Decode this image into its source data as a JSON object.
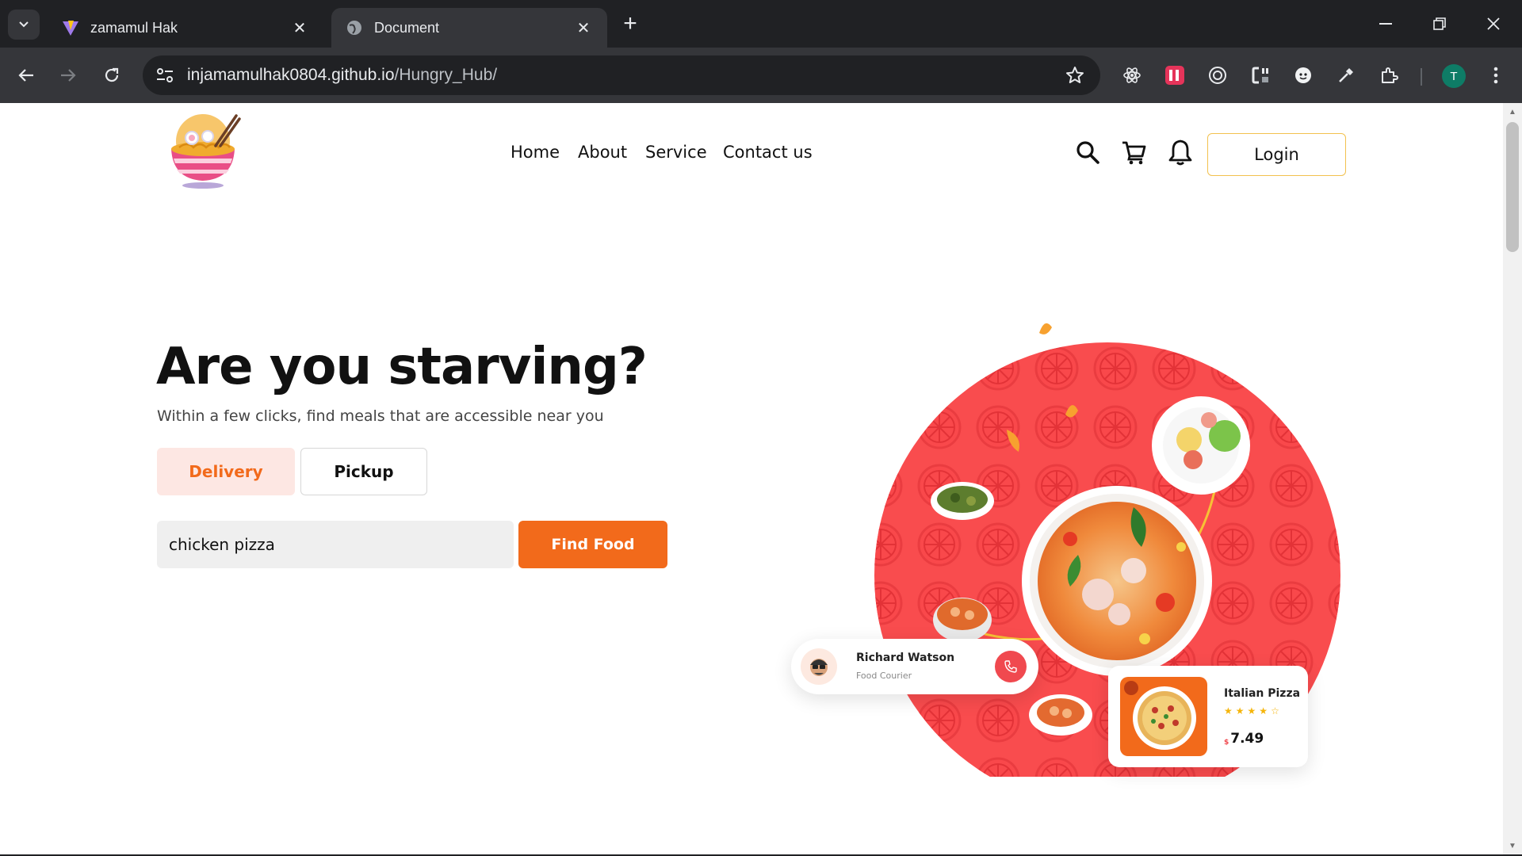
{
  "browser": {
    "tabs": [
      {
        "title": "zamamul Hak",
        "active": false
      },
      {
        "title": "Document",
        "active": true
      }
    ],
    "url_host": "injamamulhak0804.github.io",
    "url_path": "/Hungry_Hub/",
    "profile_initial": "T"
  },
  "header": {
    "nav": [
      "Home",
      "About",
      "Service",
      "Contact us"
    ],
    "login_label": "Login"
  },
  "hero": {
    "headline": "Are you starving?",
    "subline": "Within a few clicks, find meals that are accessible near you",
    "tabs": {
      "delivery": "Delivery",
      "pickup": "Pickup"
    },
    "search_value": "chicken pizza",
    "find_label": "Find Food"
  },
  "courier_card": {
    "name": "Richard Watson",
    "role": "Food Courier"
  },
  "pizza_card": {
    "name": "Italian Pizza",
    "rating": 4,
    "rating_max": 5,
    "currency": "$",
    "price": "7.49"
  },
  "colors": {
    "accent": "#f26a1b",
    "hero_red": "#f0494f",
    "login_border": "#f2c14e"
  }
}
